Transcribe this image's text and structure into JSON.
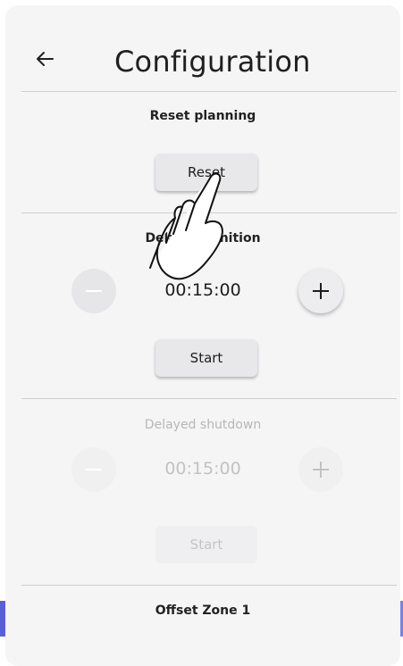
{
  "header": {
    "title": "Configuration",
    "back_icon": "arrow-left-icon"
  },
  "reset_planning": {
    "title": "Reset planning",
    "button_label": "Reset"
  },
  "delayed_ignition": {
    "title": "Delayed ignition",
    "time": "00:15:00",
    "decrement_icon": "minus-icon",
    "increment_icon": "plus-icon",
    "start_label": "Start",
    "enabled": true
  },
  "delayed_shutdown": {
    "title": "Delayed shutdown",
    "time": "00:15:00",
    "decrement_icon": "minus-icon",
    "increment_icon": "plus-icon",
    "start_label": "Start",
    "enabled": false
  },
  "offset_zone": {
    "title": "Offset Zone 1"
  },
  "overlay": {
    "icon": "pointing-hand-icon"
  },
  "colors": {
    "card_bg": "#f5f5f6",
    "accent": "#5b5fd6",
    "divider": "#cfcfd2",
    "disabled_text": "#b7b7ba"
  }
}
